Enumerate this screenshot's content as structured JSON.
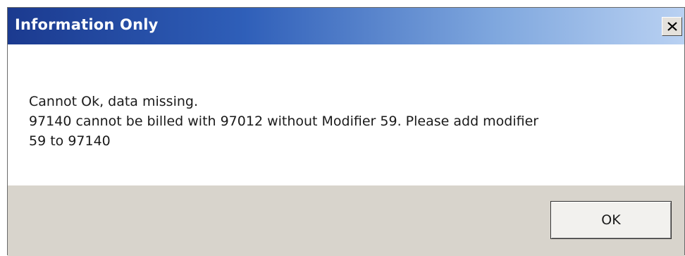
{
  "window": {
    "title": "Information Only",
    "close_icon": "close-icon"
  },
  "message": {
    "lines": [
      "Cannot Ok, data missing.",
      "97140 cannot be billed with 97012 without Modifier 59. Please add modifier",
      "59 to 97140"
    ]
  },
  "buttons": {
    "ok_label": "OK"
  },
  "colors": {
    "title_gradient_start": "#1b3a8f",
    "title_gradient_end": "#b9d1f2",
    "footer_background": "#d8d4cc"
  }
}
